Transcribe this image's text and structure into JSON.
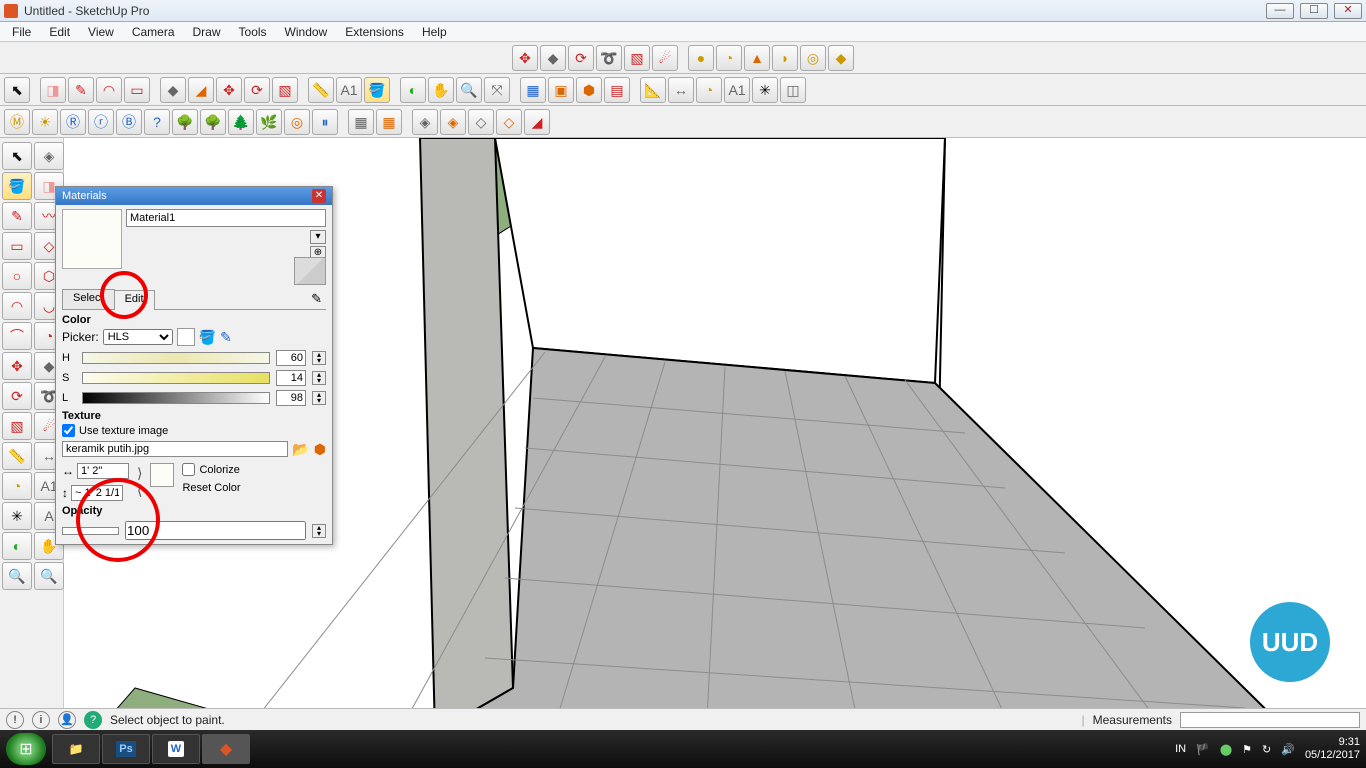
{
  "window": {
    "title": "Untitled - SketchUp Pro"
  },
  "menu": [
    "File",
    "Edit",
    "View",
    "Camera",
    "Draw",
    "Tools",
    "Window",
    "Extensions",
    "Help"
  ],
  "materials": {
    "panel_title": "Materials",
    "name": "Material1",
    "tabs": {
      "select": "Select",
      "edit": "Edit"
    },
    "section_color": "Color",
    "picker_label": "Picker:",
    "picker_value": "HLS",
    "hls": {
      "h_label": "H",
      "h": "60",
      "s_label": "S",
      "s": "14",
      "l_label": "L",
      "l": "98"
    },
    "section_texture": "Texture",
    "use_texture_label": "Use texture image",
    "texture_file": "keramik putih.jpg",
    "dim_w": "1' 2\"",
    "dim_h": "~ 1' 2 1/1",
    "colorize_label": "Colorize",
    "reset_label": "Reset Color",
    "section_opacity": "Opacity",
    "opacity": "100"
  },
  "status": {
    "hint": "Select object to paint.",
    "meas_label": "Measurements"
  },
  "taskbar": {
    "lang": "IN",
    "time": "9:31",
    "date": "05/12/2017"
  },
  "badge": "UUD"
}
